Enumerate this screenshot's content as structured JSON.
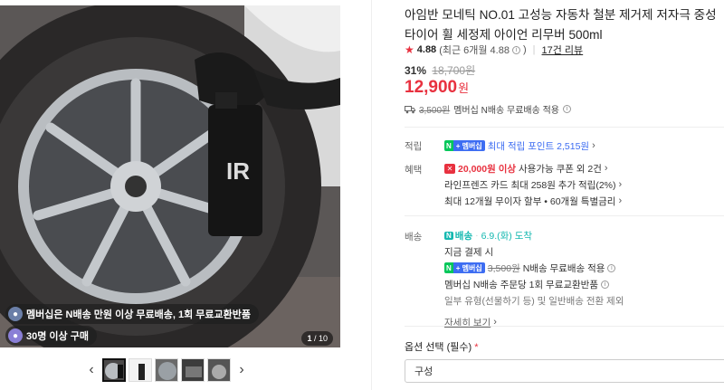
{
  "gallery": {
    "badges": [
      {
        "icon": "gift-icon",
        "text": "멤버십은 N배송 만원 이상 무료배송, 1회 무료교환반품"
      },
      {
        "icon": "user-icon",
        "text": "30명 이상 구매"
      }
    ],
    "counter_current": "1",
    "counter_total": "/ 10",
    "prev_label": "‹",
    "next_label": "›",
    "thumbnail_count": 5
  },
  "product": {
    "title_line1": "아임반 모네틱 NO.01 고성능 자동차 철분 제거제 저자극 중성",
    "title_line2": "타이어 휠 세정제 아이언 리무버 500ml",
    "rating_score": "4.88",
    "rating_detail": "(최근 6개월 4.88",
    "rating_close": ")",
    "review_link": "17건 리뷰",
    "discount_pct": "31%",
    "original_price": "18,700원",
    "sale_price": "12,900",
    "sale_unit": "원",
    "ship_orig": "3,500원",
    "ship_text": "멤버십 N배송 무료배송 적용"
  },
  "points": {
    "label": "적립",
    "npay_n": "N",
    "npay_m": "+ 멤버십",
    "text": "최대 적립 포인트 2,515원"
  },
  "benefits": {
    "label": "혜택",
    "coupon_amount": "20,000원 이상",
    "coupon_text": "사용가능 쿠폰 외 2건",
    "card_text": "라인프렌즈 카드 최대 258원 추가 적립(2%)",
    "installment_text": "최대 12개월 무이자 할부 • 60개월 특별금리"
  },
  "delivery": {
    "label": "배송",
    "badge_text": "배송",
    "arrival": "6.9.(화) 도착",
    "condition": "지금 결제 시",
    "npay_n": "N",
    "npay_m": "+ 멤버십",
    "ship_orig": "3,500원",
    "ship_text": "N배송 무료배송 적용",
    "exchange_text": "멤버십 N배송 주문당 1회 무료교환반품",
    "exclude_text": "일부 유형(선물하기 등) 및 일반배송 전환 제외",
    "more_link": "자세히 보기"
  },
  "option": {
    "label": "옵션 선택 (필수)",
    "required_mark": "*",
    "select_value": "구성"
  },
  "colors": {
    "accent_red": "#e8313f",
    "naver_green": "#03c75a",
    "membership_blue": "#3d6df2",
    "delivery_teal": "#14b8b0"
  }
}
